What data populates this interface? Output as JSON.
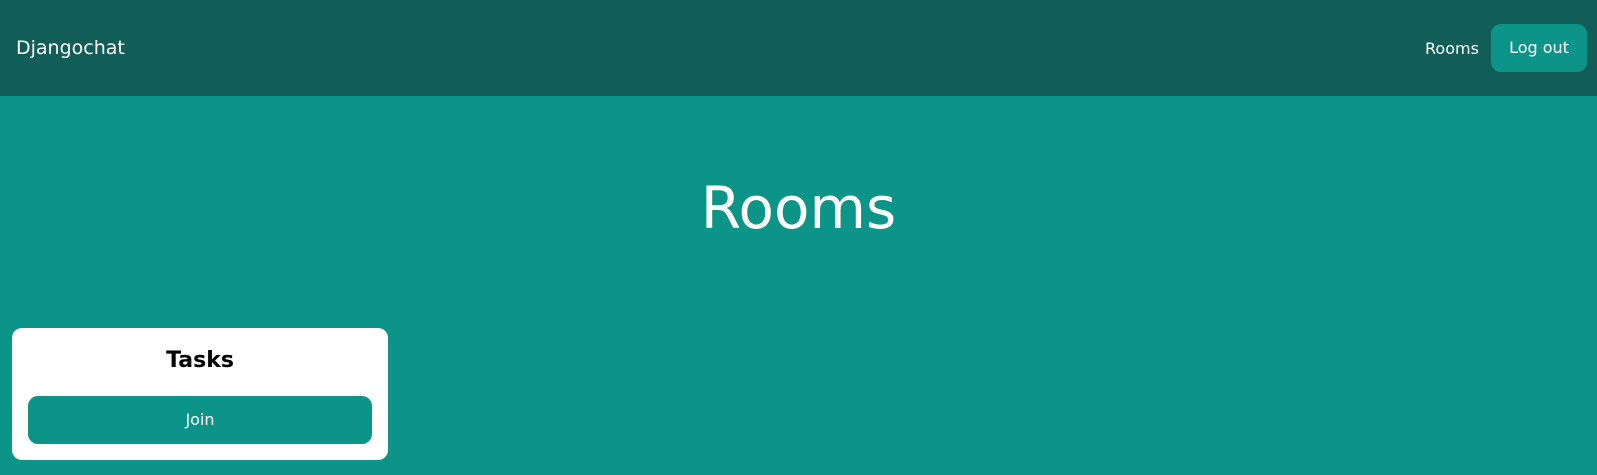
{
  "nav": {
    "brand": "Djangochat",
    "rooms_link": "Rooms",
    "logout_label": "Log out"
  },
  "page": {
    "title": "Rooms"
  },
  "rooms": [
    {
      "name": "Tasks",
      "join_label": "Join"
    }
  ],
  "colors": {
    "navbar": "#115e59",
    "background": "#0d9488",
    "button": "#0d9488",
    "card": "#ffffff"
  }
}
